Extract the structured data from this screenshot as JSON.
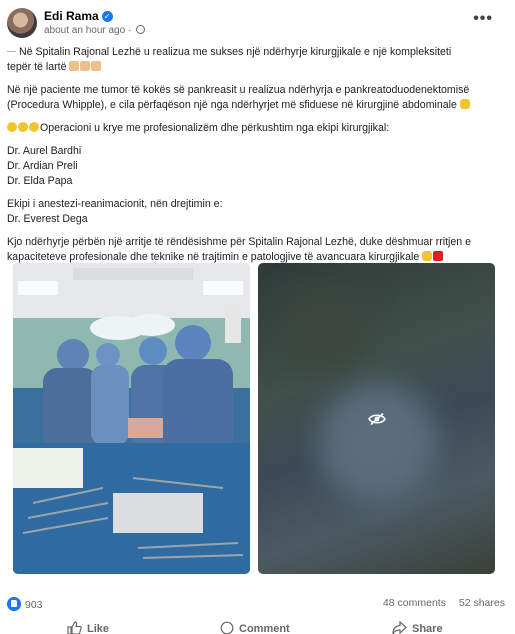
{
  "post": {
    "author": "Edi Rama",
    "timestamp": "about an hour ago",
    "paragraphs": [
      [
        "Në Spitalin Rajonal Lezhë u realizua me sukses një ndërhyrje kirurgjikale e një kompleksiteti",
        "tepër të lartë"
      ],
      [
        "Në një paciente me tumor të kokës së pankreasit u realizua ndërhyrja e pankreatoduodenektomisë",
        "(Procedura Whipple), e cila përfaqëson një nga ndërhyrjet më sfiduese në kirurgjinë abdominale"
      ],
      [
        "Operacioni u kryе me profesionalizëm dhe përkushtim nga ekipi kirurgjikal:"
      ],
      [
        "Dr. Aurel Bardhi",
        "Dr. Ardian Preli",
        "Dr. Elda Papa"
      ],
      [
        "Ekipi i anestezi-reanimacionit, nën drejtimin e:",
        "Dr. Everest Dega"
      ],
      [
        "Kjo ndërhyrje përbën një arritje të rëndësishme për Spitalin Rajonal Lezhë, duke dëshmuar rritjen e",
        "kapaciteteve profesionale dhe teknike në trajtimin e patologjive të avancuara kirurgjikale"
      ]
    ],
    "icons": {
      "verified": "verified-badge-icon",
      "privacy": "globe-icon",
      "menu": "more-options-icon",
      "hidden_media": "eye-off-icon"
    }
  },
  "stats": {
    "reactions": "903",
    "comments": "48 comments",
    "shares": "52 shares"
  },
  "actions": {
    "like": "Like",
    "comment": "Comment",
    "share": "Share"
  },
  "colors": {
    "brand": "#1877f2",
    "secondary_text": "#65676b"
  }
}
